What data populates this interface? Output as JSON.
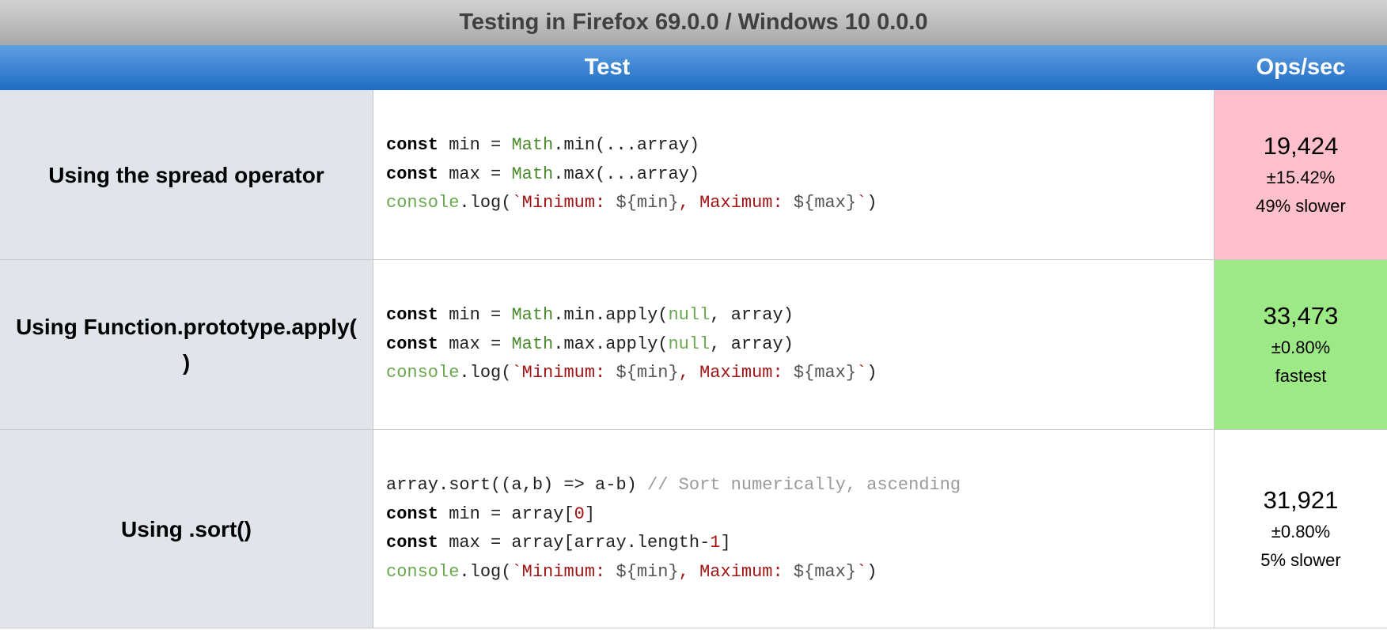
{
  "environment": "Testing in Firefox 69.0.0 / Windows 10 0.0.0",
  "headers": {
    "test": "Test",
    "ops": "Ops/sec"
  },
  "tests": [
    {
      "title": "Using the spread operator",
      "code": {
        "line1": {
          "kw": "const",
          "rest": " min = ",
          "glb": "Math",
          "tail": ".min(...array)"
        },
        "line2": {
          "kw": "const",
          "rest": " max = ",
          "glb": "Math",
          "tail": ".max(...array)"
        },
        "line3": {
          "console": "console",
          "log": ".log(",
          "str1": "`Minimum: ",
          "i1": "${min}",
          "str2": ", Maximum: ",
          "i2": "${max}",
          "str3": "`",
          "close": ")"
        }
      },
      "ops": "19,424",
      "error": "±15.42%",
      "rank": "49% slower",
      "status": "slow",
      "status_color": "#ffc0cb"
    },
    {
      "title": "Using Function.prototype.apply( )",
      "code": {
        "line1": {
          "kw": "const",
          "rest": " min = ",
          "glb": "Math",
          "mid": ".min.apply(",
          "lit": "null",
          "tail": ", array)"
        },
        "line2": {
          "kw": "const",
          "rest": " max = ",
          "glb": "Math",
          "mid": ".max.apply(",
          "lit": "null",
          "tail": ", array)"
        },
        "line3": {
          "console": "console",
          "log": ".log(",
          "str1": "`Minimum: ",
          "i1": "${min}",
          "str2": ", Maximum: ",
          "i2": "${max}",
          "str3": "`",
          "close": ")"
        }
      },
      "ops": "33,473",
      "error": "±0.80%",
      "rank": "fastest",
      "status": "fast",
      "status_color": "#9ce986"
    },
    {
      "title": "Using .sort()",
      "code": {
        "line0": {
          "code": "array.sort((a,b) => a-b) ",
          "comment": "// Sort numerically, ascending"
        },
        "line1": {
          "kw": "const",
          "rest": " min = array[",
          "num": "0",
          "tail": "]"
        },
        "line2": {
          "kw": "const",
          "rest": " max = array[array.length-",
          "num": "1",
          "tail": "]"
        },
        "line3": {
          "console": "console",
          "log": ".log(",
          "str1": "`Minimum: ",
          "i1": "${min}",
          "str2": ", Maximum: ",
          "i2": "${max}",
          "str3": "`",
          "close": ")"
        }
      },
      "ops": "31,921",
      "error": "±0.80%",
      "rank": "5% slower",
      "status": "neutral",
      "status_color": "#ffffff"
    }
  ]
}
